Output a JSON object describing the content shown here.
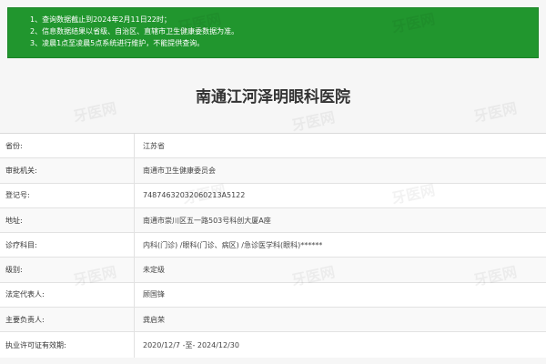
{
  "notice": {
    "lines": [
      "1、查询数据截止到2024年2月11日22时；",
      "2、信息数据结果以省级、自治区、直辖市卫生健康委数据为准。",
      "3、凌晨1点至凌晨5点系统进行维护，不能提供查询。"
    ]
  },
  "title": "南通江河泽明眼科医院",
  "rows": [
    {
      "label": "省份:",
      "value": "江苏省"
    },
    {
      "label": "审批机关:",
      "value": "南通市卫生健康委员会"
    },
    {
      "label": "登记号:",
      "value": "74874632032060213A5122"
    },
    {
      "label": "地址:",
      "value": "南通市崇川区五一路503号科创大厦A座"
    },
    {
      "label": "诊疗科目:",
      "value": "内科(门诊) /眼科(门诊、病区) /急诊医学科(眼科)******"
    },
    {
      "label": "级别:",
      "value": "未定级"
    },
    {
      "label": "法定代表人:",
      "value": "顾国锋"
    },
    {
      "label": "主要负责人:",
      "value": "龚启荣"
    },
    {
      "label": "执业许可证有效期:",
      "value": "2020/12/7 -至- 2024/12/30"
    }
  ],
  "watermark": "牙医网"
}
